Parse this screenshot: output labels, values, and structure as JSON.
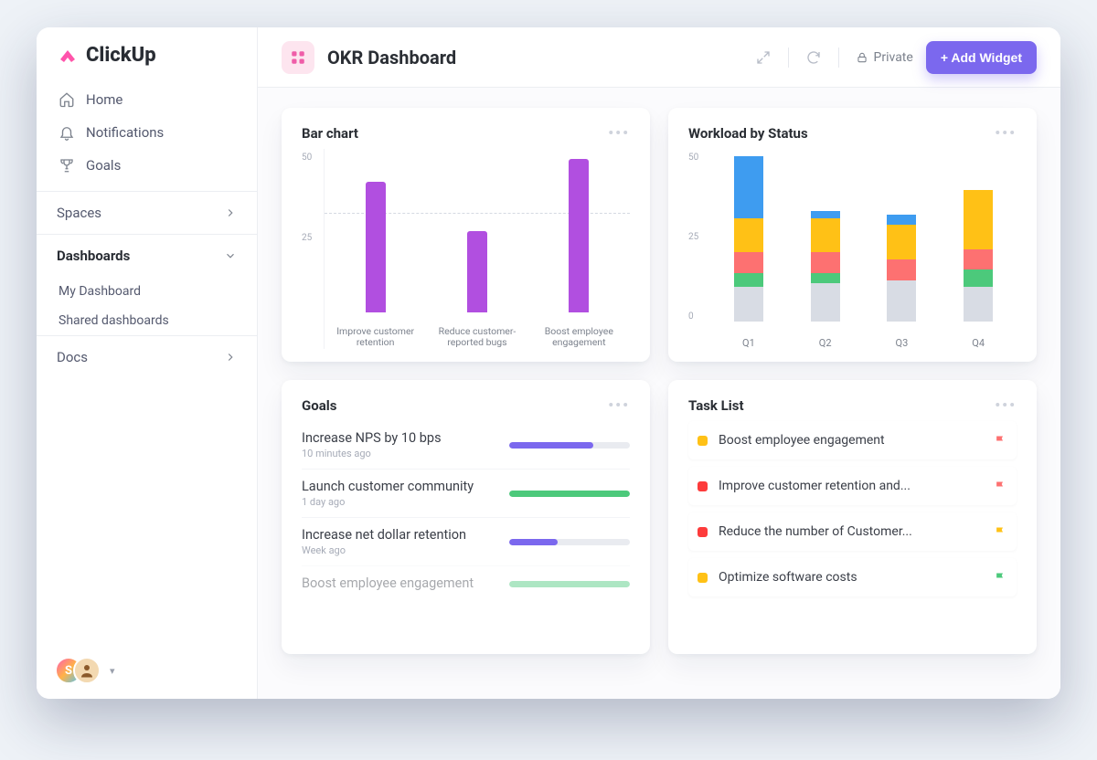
{
  "brand": "ClickUp",
  "nav": [
    {
      "label": "Home",
      "icon": "home-icon"
    },
    {
      "label": "Notifications",
      "icon": "bell-icon"
    },
    {
      "label": "Goals",
      "icon": "trophy-icon"
    }
  ],
  "sections": {
    "spaces": {
      "label": "Spaces"
    },
    "dashboards": {
      "label": "Dashboards",
      "items": [
        "My Dashboard",
        "Shared dashboards"
      ]
    },
    "docs": {
      "label": "Docs"
    }
  },
  "avatar_badge": "S",
  "header": {
    "title": "OKR Dashboard",
    "privacy": "Private",
    "add_widget": "+ Add Widget"
  },
  "cards": {
    "bar": {
      "title": "Bar chart"
    },
    "workload": {
      "title": "Workload by Status"
    },
    "goals": {
      "title": "Goals"
    },
    "tasks": {
      "title": "Task List"
    }
  },
  "colors": {
    "purple_bar": "#b14fe0",
    "blue": "#3e9cf0",
    "yellow": "#ffc116",
    "red": "#fd7171",
    "green": "#4cc97b",
    "grey": "#d8dce4",
    "violet": "#7b68ee",
    "prog_green": "#4cc97b"
  },
  "goals_list": [
    {
      "title": "Increase NPS by 10 bps",
      "time": "10 minutes ago",
      "progress": 70,
      "color": "#7b68ee"
    },
    {
      "title": "Launch customer community",
      "time": "1 day ago",
      "progress": 100,
      "color": "#4cc97b"
    },
    {
      "title": "Increase net dollar retention",
      "time": "Week ago",
      "progress": 40,
      "color": "#7b68ee"
    },
    {
      "title": "Boost employee engagement",
      "time": "",
      "progress": 100,
      "color": "#4cc97b",
      "faded": true
    }
  ],
  "task_list": [
    {
      "title": "Boost employee engagement",
      "sq": "#ffc116",
      "flag": "#fd7171"
    },
    {
      "title": "Improve customer retention and...",
      "sq": "#fd3b3b",
      "flag": "#fd7171"
    },
    {
      "title": "Reduce the number of Customer...",
      "sq": "#fd3b3b",
      "flag": "#ffc116"
    },
    {
      "title": "Optimize software costs",
      "sq": "#ffc116",
      "flag": "#4cc97b"
    }
  ],
  "chart_data": [
    {
      "id": "bar_chart",
      "type": "bar",
      "title": "Bar chart",
      "categories": [
        "Improve customer retention",
        "Reduce customer-reported bugs",
        "Boost employee engagement"
      ],
      "values": [
        40,
        25,
        47
      ],
      "ylim": [
        0,
        50
      ],
      "yticks": [
        50,
        25
      ],
      "reference_line": 33
    },
    {
      "id": "workload_by_status",
      "type": "stacked_bar",
      "title": "Workload by Status",
      "categories": [
        "Q1",
        "Q2",
        "Q3",
        "Q4"
      ],
      "series": [
        {
          "name": "grey",
          "color": "#d8dce4",
          "values": [
            10,
            11,
            12,
            10
          ]
        },
        {
          "name": "green",
          "color": "#4cc97b",
          "values": [
            4,
            3,
            0,
            5
          ]
        },
        {
          "name": "red",
          "color": "#fd7171",
          "values": [
            6,
            6,
            6,
            6
          ]
        },
        {
          "name": "yellow",
          "color": "#ffc116",
          "values": [
            10,
            10,
            10,
            17
          ]
        },
        {
          "name": "blue",
          "color": "#3e9cf0",
          "values": [
            18,
            2,
            3,
            0
          ]
        }
      ],
      "ylim": [
        0,
        50
      ],
      "yticks": [
        50,
        25,
        0
      ]
    }
  ]
}
